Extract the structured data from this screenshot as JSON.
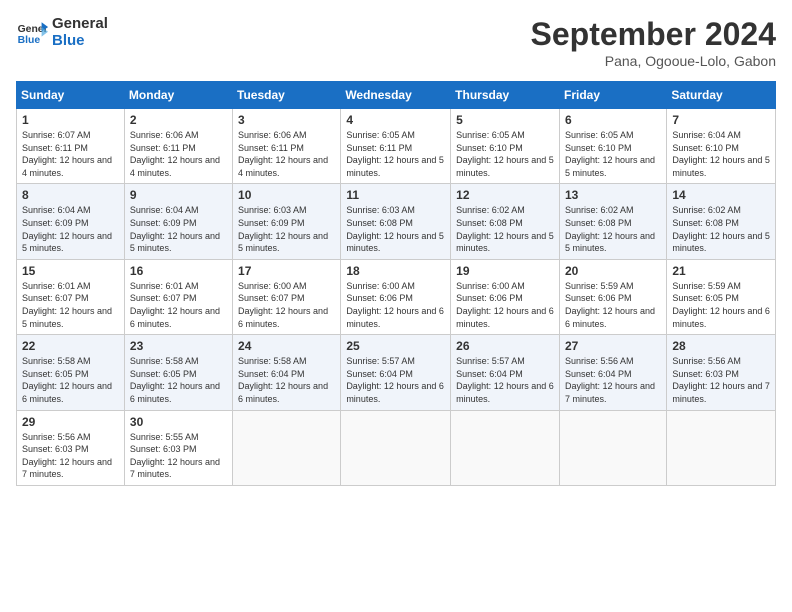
{
  "header": {
    "logo_line1": "General",
    "logo_line2": "Blue",
    "month": "September 2024",
    "location": "Pana, Ogooue-Lolo, Gabon"
  },
  "weekdays": [
    "Sunday",
    "Monday",
    "Tuesday",
    "Wednesday",
    "Thursday",
    "Friday",
    "Saturday"
  ],
  "weeks": [
    [
      {
        "day": "1",
        "rise": "6:07 AM",
        "set": "6:11 PM",
        "daylight": "12 hours and 4 minutes."
      },
      {
        "day": "2",
        "rise": "6:06 AM",
        "set": "6:11 PM",
        "daylight": "12 hours and 4 minutes."
      },
      {
        "day": "3",
        "rise": "6:06 AM",
        "set": "6:11 PM",
        "daylight": "12 hours and 4 minutes."
      },
      {
        "day": "4",
        "rise": "6:05 AM",
        "set": "6:11 PM",
        "daylight": "12 hours and 5 minutes."
      },
      {
        "day": "5",
        "rise": "6:05 AM",
        "set": "6:10 PM",
        "daylight": "12 hours and 5 minutes."
      },
      {
        "day": "6",
        "rise": "6:05 AM",
        "set": "6:10 PM",
        "daylight": "12 hours and 5 minutes."
      },
      {
        "day": "7",
        "rise": "6:04 AM",
        "set": "6:10 PM",
        "daylight": "12 hours and 5 minutes."
      }
    ],
    [
      {
        "day": "8",
        "rise": "6:04 AM",
        "set": "6:09 PM",
        "daylight": "12 hours and 5 minutes."
      },
      {
        "day": "9",
        "rise": "6:04 AM",
        "set": "6:09 PM",
        "daylight": "12 hours and 5 minutes."
      },
      {
        "day": "10",
        "rise": "6:03 AM",
        "set": "6:09 PM",
        "daylight": "12 hours and 5 minutes."
      },
      {
        "day": "11",
        "rise": "6:03 AM",
        "set": "6:08 PM",
        "daylight": "12 hours and 5 minutes."
      },
      {
        "day": "12",
        "rise": "6:02 AM",
        "set": "6:08 PM",
        "daylight": "12 hours and 5 minutes."
      },
      {
        "day": "13",
        "rise": "6:02 AM",
        "set": "6:08 PM",
        "daylight": "12 hours and 5 minutes."
      },
      {
        "day": "14",
        "rise": "6:02 AM",
        "set": "6:08 PM",
        "daylight": "12 hours and 5 minutes."
      }
    ],
    [
      {
        "day": "15",
        "rise": "6:01 AM",
        "set": "6:07 PM",
        "daylight": "12 hours and 5 minutes."
      },
      {
        "day": "16",
        "rise": "6:01 AM",
        "set": "6:07 PM",
        "daylight": "12 hours and 6 minutes."
      },
      {
        "day": "17",
        "rise": "6:00 AM",
        "set": "6:07 PM",
        "daylight": "12 hours and 6 minutes."
      },
      {
        "day": "18",
        "rise": "6:00 AM",
        "set": "6:06 PM",
        "daylight": "12 hours and 6 minutes."
      },
      {
        "day": "19",
        "rise": "6:00 AM",
        "set": "6:06 PM",
        "daylight": "12 hours and 6 minutes."
      },
      {
        "day": "20",
        "rise": "5:59 AM",
        "set": "6:06 PM",
        "daylight": "12 hours and 6 minutes."
      },
      {
        "day": "21",
        "rise": "5:59 AM",
        "set": "6:05 PM",
        "daylight": "12 hours and 6 minutes."
      }
    ],
    [
      {
        "day": "22",
        "rise": "5:58 AM",
        "set": "6:05 PM",
        "daylight": "12 hours and 6 minutes."
      },
      {
        "day": "23",
        "rise": "5:58 AM",
        "set": "6:05 PM",
        "daylight": "12 hours and 6 minutes."
      },
      {
        "day": "24",
        "rise": "5:58 AM",
        "set": "6:04 PM",
        "daylight": "12 hours and 6 minutes."
      },
      {
        "day": "25",
        "rise": "5:57 AM",
        "set": "6:04 PM",
        "daylight": "12 hours and 6 minutes."
      },
      {
        "day": "26",
        "rise": "5:57 AM",
        "set": "6:04 PM",
        "daylight": "12 hours and 6 minutes."
      },
      {
        "day": "27",
        "rise": "5:56 AM",
        "set": "6:04 PM",
        "daylight": "12 hours and 7 minutes."
      },
      {
        "day": "28",
        "rise": "5:56 AM",
        "set": "6:03 PM",
        "daylight": "12 hours and 7 minutes."
      }
    ],
    [
      {
        "day": "29",
        "rise": "5:56 AM",
        "set": "6:03 PM",
        "daylight": "12 hours and 7 minutes."
      },
      {
        "day": "30",
        "rise": "5:55 AM",
        "set": "6:03 PM",
        "daylight": "12 hours and 7 minutes."
      },
      null,
      null,
      null,
      null,
      null
    ]
  ]
}
